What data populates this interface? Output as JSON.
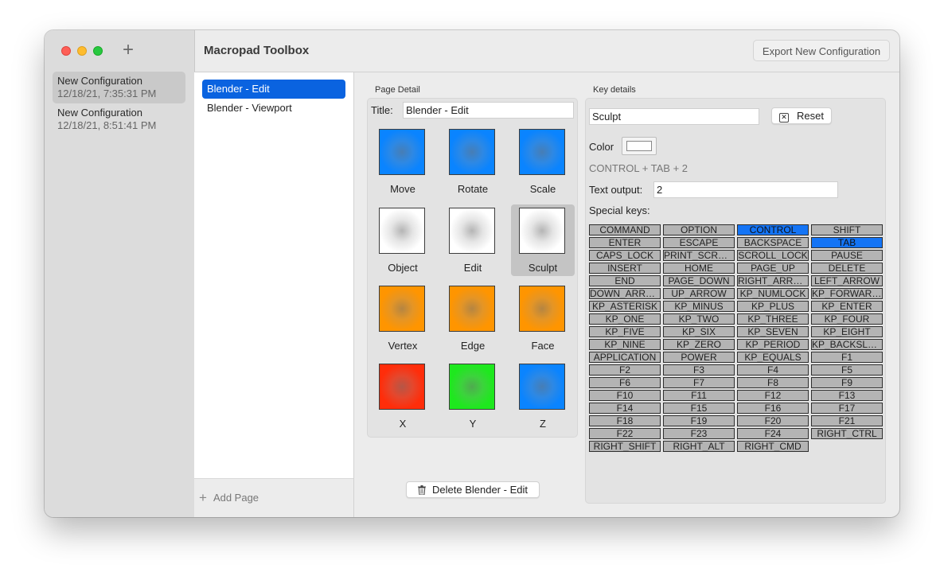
{
  "app": {
    "title": "Macropad Toolbox",
    "export_label": "Export New Configuration"
  },
  "sidebar": {
    "add_icon": "plus-icon",
    "configs": [
      {
        "name": "New Configuration",
        "date": "12/18/21, 7:35:31 PM",
        "selected": true
      },
      {
        "name": "New Configuration",
        "date": "12/18/21, 8:51:41 PM",
        "selected": false
      }
    ]
  },
  "pages": {
    "items": [
      {
        "label": "Blender - Edit",
        "selected": true
      },
      {
        "label": "Blender - Viewport",
        "selected": false
      }
    ],
    "add_label": "Add Page"
  },
  "page_detail": {
    "section_label": "Page Detail",
    "title_label": "Title:",
    "title_value": "Blender - Edit",
    "keys": [
      {
        "name": "Move",
        "color": "#0a84ff"
      },
      {
        "name": "Rotate",
        "color": "#0a84ff"
      },
      {
        "name": "Scale",
        "color": "#0a84ff"
      },
      {
        "name": "Object",
        "color": "#ffffff"
      },
      {
        "name": "Edit",
        "color": "#ffffff"
      },
      {
        "name": "Sculpt",
        "color": "#ffffff",
        "selected": true
      },
      {
        "name": "Vertex",
        "color": "#ff9500"
      },
      {
        "name": "Edge",
        "color": "#ff9500"
      },
      {
        "name": "Face",
        "color": "#ff9500"
      },
      {
        "name": "X",
        "color": "#ff2d0a"
      },
      {
        "name": "Y",
        "color": "#1ee81e"
      },
      {
        "name": "Z",
        "color": "#0a84ff"
      }
    ],
    "delete_label": "Delete Blender - Edit"
  },
  "key_details": {
    "section_label": "Key details",
    "name_value": "Sculpt",
    "reset_label": "Reset",
    "color_label": "Color",
    "color_value": "#ffffff",
    "combo_text": "CONTROL + TAB + 2",
    "text_output_label": "Text output:",
    "text_output_value": "2",
    "special_keys_label": "Special keys:",
    "special_keys": [
      "COMMAND",
      "OPTION",
      "CONTROL",
      "SHIFT",
      "ENTER",
      "ESCAPE",
      "BACKSPACE",
      "TAB",
      "CAPS_LOCK",
      "PRINT_SCREEN",
      "SCROLL_LOCK",
      "PAUSE",
      "INSERT",
      "HOME",
      "PAGE_UP",
      "DELETE",
      "END",
      "PAGE_DOWN",
      "RIGHT_ARROW",
      "LEFT_ARROW",
      "DOWN_ARROW",
      "UP_ARROW",
      "KP_NUMLOCK",
      "KP_FORWARD...",
      "KP_ASTERISK",
      "KP_MINUS",
      "KP_PLUS",
      "KP_ENTER",
      "KP_ONE",
      "KP_TWO",
      "KP_THREE",
      "KP_FOUR",
      "KP_FIVE",
      "KP_SIX",
      "KP_SEVEN",
      "KP_EIGHT",
      "KP_NINE",
      "KP_ZERO",
      "KP_PERIOD",
      "KP_BACKSLA...",
      "APPLICATION",
      "POWER",
      "KP_EQUALS",
      "F1",
      "F2",
      "F3",
      "F4",
      "F5",
      "F6",
      "F7",
      "F8",
      "F9",
      "F10",
      "F11",
      "F12",
      "F13",
      "F14",
      "F15",
      "F16",
      "F17",
      "F18",
      "F19",
      "F20",
      "F21",
      "F22",
      "F23",
      "F24",
      "RIGHT_CTRL",
      "RIGHT_SHIFT",
      "RIGHT_ALT",
      "RIGHT_CMD"
    ],
    "active_keys": [
      "CONTROL",
      "TAB"
    ],
    "active_color": "#1474f5"
  }
}
